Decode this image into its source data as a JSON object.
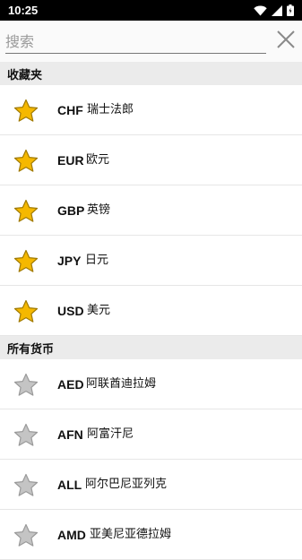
{
  "status_bar": {
    "time": "10:25"
  },
  "search": {
    "placeholder": "搜索",
    "value": ""
  },
  "favorites": {
    "title": "收藏夹",
    "items": [
      {
        "code": "CHF",
        "name": "瑞士法郎",
        "starred": true
      },
      {
        "code": "EUR",
        "name": "欧元",
        "starred": true
      },
      {
        "code": "GBP",
        "name": "英镑",
        "starred": true
      },
      {
        "code": "JPY",
        "name": "日元",
        "starred": true
      },
      {
        "code": "USD",
        "name": "美元",
        "starred": true
      }
    ]
  },
  "all_currencies": {
    "title": "所有货币",
    "items": [
      {
        "code": "AED",
        "name": "阿联酋迪拉姆",
        "starred": false
      },
      {
        "code": "AFN",
        "name": "阿富汗尼",
        "starred": false
      },
      {
        "code": "ALL",
        "name": "阿尔巴尼亚列克",
        "starred": false
      },
      {
        "code": "AMD",
        "name": "亚美尼亚德拉姆",
        "starred": false
      }
    ]
  },
  "colors": {
    "star_gold": "#f5b800",
    "star_gray": "#c4c4c4",
    "section_bg": "#ebebeb",
    "status_bar_bg": "#000000"
  },
  "icons": {
    "wifi": "wifi-icon",
    "signal": "signal-icon",
    "battery": "battery-icon",
    "clear": "close-icon",
    "favorite": "star-icon"
  }
}
